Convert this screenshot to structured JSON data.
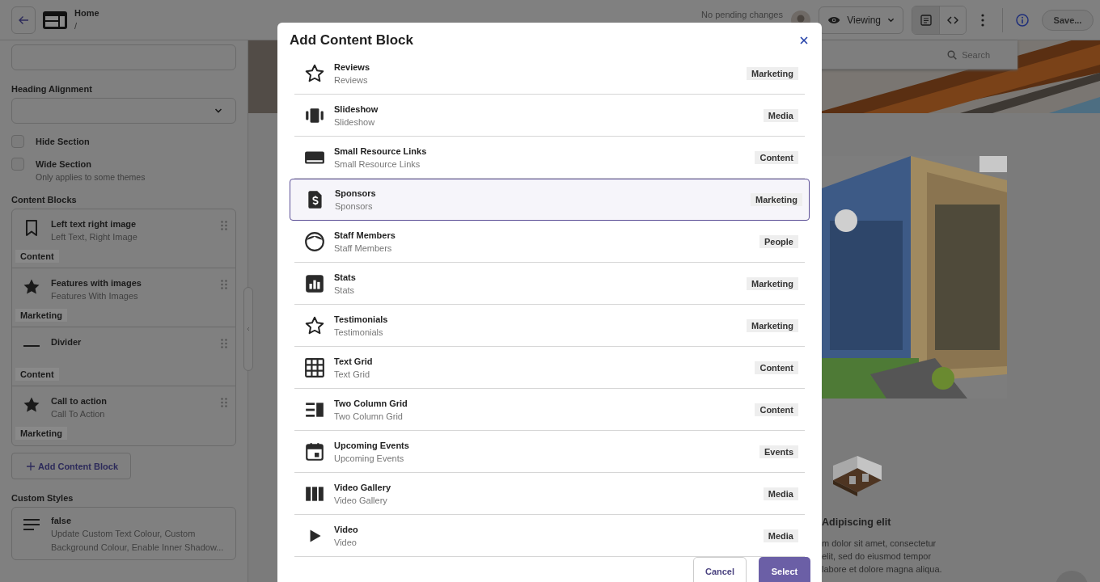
{
  "topbar": {
    "title": "Home",
    "path": "/",
    "status": "No pending changes",
    "view_mode": "Viewing",
    "save": "Save..."
  },
  "sidebar": {
    "heading_alignment_label": "Heading Alignment",
    "checkboxes": [
      {
        "label": "Hide Section",
        "checked": false
      },
      {
        "label": "Wide Section",
        "hint": "Only applies to some themes",
        "checked": false
      }
    ],
    "content_blocks_label": "Content Blocks",
    "blocks": [
      {
        "title": "Left text right image",
        "subtitle": "Left Text, Right Image",
        "tag": "Content"
      },
      {
        "title": "Features with images",
        "subtitle": "Features With Images",
        "tag": "Marketing"
      },
      {
        "title": "Divider",
        "tag": "Content"
      },
      {
        "title": "Call to action",
        "subtitle": "Call To Action",
        "tag": "Marketing"
      }
    ],
    "add_button": "Add Content Block",
    "custom_styles_label": "Custom Styles",
    "custom_styles": {
      "title": "false",
      "description": "Update Custom Text Colour, Custom Background Colour, Enable Inner Shadow..."
    }
  },
  "preview": {
    "search_placeholder": "Search",
    "heading": "Adipiscing elit",
    "paragraph_lines": [
      "m dolor sit amet, consectetur",
      "elit, sed do eiusmod tempor",
      "labore et dolore magna aliqua."
    ]
  },
  "modal": {
    "title": "Add Content Block",
    "items": [
      {
        "title": "Reviews",
        "subtitle": "Reviews",
        "tag": "Marketing",
        "selected": false
      },
      {
        "title": "Slideshow",
        "subtitle": "Slideshow",
        "tag": "Media",
        "selected": false
      },
      {
        "title": "Small Resource Links",
        "subtitle": "Small Resource Links",
        "tag": "Content",
        "selected": false
      },
      {
        "title": "Sponsors",
        "subtitle": "Sponsors",
        "tag": "Marketing",
        "selected": true
      },
      {
        "title": "Staff Members",
        "subtitle": "Staff Members",
        "tag": "People",
        "selected": false
      },
      {
        "title": "Stats",
        "subtitle": "Stats",
        "tag": "Marketing",
        "selected": false
      },
      {
        "title": "Testimonials",
        "subtitle": "Testimonials",
        "tag": "Marketing",
        "selected": false
      },
      {
        "title": "Text Grid",
        "subtitle": "Text Grid",
        "tag": "Content",
        "selected": false
      },
      {
        "title": "Two Column Grid",
        "subtitle": "Two Column Grid",
        "tag": "Content",
        "selected": false
      },
      {
        "title": "Upcoming Events",
        "subtitle": "Upcoming Events",
        "tag": "Events",
        "selected": false
      },
      {
        "title": "Video Gallery",
        "subtitle": "Video Gallery",
        "tag": "Media",
        "selected": false
      },
      {
        "title": "Video",
        "subtitle": "Video",
        "tag": "Media",
        "selected": false
      }
    ],
    "cancel": "Cancel",
    "select": "Select"
  }
}
